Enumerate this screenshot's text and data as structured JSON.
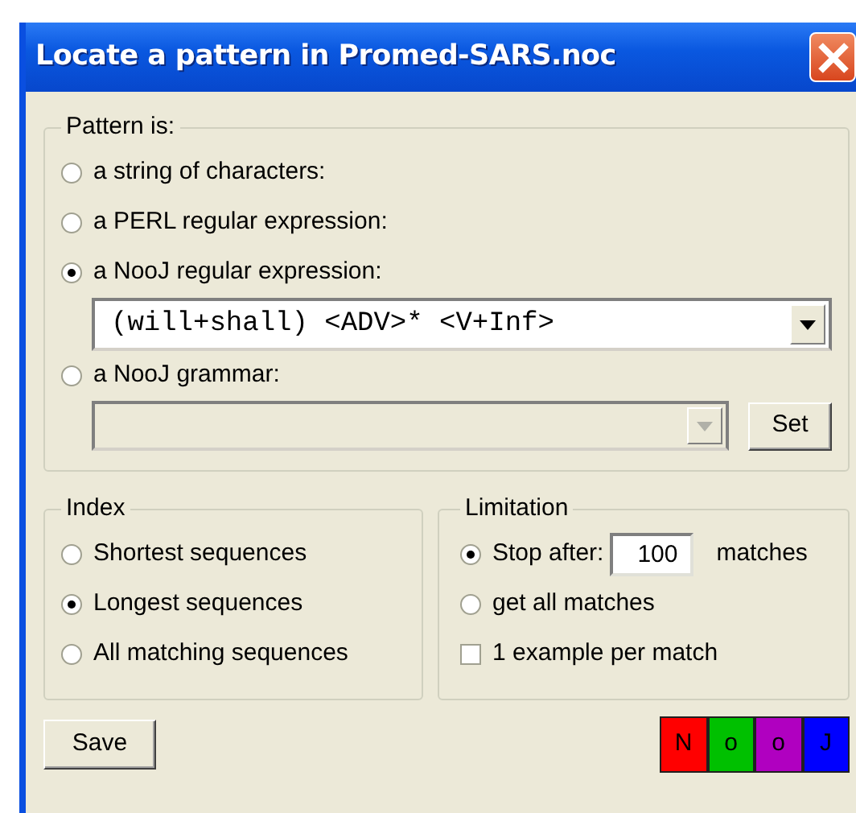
{
  "window": {
    "title": "Locate a pattern in Promed-SARS.noc"
  },
  "pattern": {
    "legend": "Pattern is:",
    "options": [
      {
        "label": "a string of characters:",
        "selected": false
      },
      {
        "label": "a PERL regular expression:",
        "selected": false
      },
      {
        "label": "a NooJ regular expression:",
        "selected": true,
        "field": {
          "value": "(will+shall) <ADV>* <V+Inf>",
          "disabled": false
        }
      },
      {
        "label": "a NooJ grammar:",
        "selected": false,
        "field": {
          "disabled": true
        },
        "button": "Set"
      }
    ]
  },
  "index": {
    "legend": "Index",
    "options": [
      {
        "label": "Shortest sequences",
        "selected": false
      },
      {
        "label": "Longest sequences",
        "selected": true
      },
      {
        "label": "All matching sequences",
        "selected": false
      }
    ]
  },
  "limitation": {
    "legend": "Limitation",
    "options": [
      {
        "kind": "radio-count",
        "label": "Stop after:",
        "selected": true,
        "value": "100",
        "suffix": "matches"
      },
      {
        "kind": "radio",
        "label": "get all matches",
        "selected": false
      },
      {
        "kind": "checkbox",
        "label": "1 example per match",
        "checked": false
      }
    ]
  },
  "footer": {
    "save": "Save",
    "logo": [
      {
        "letter": "N",
        "color": "#ff0000"
      },
      {
        "letter": "o",
        "color": "#00c000"
      },
      {
        "letter": "o",
        "color": "#b000c0"
      },
      {
        "letter": "J",
        "color": "#0000ff"
      }
    ]
  }
}
